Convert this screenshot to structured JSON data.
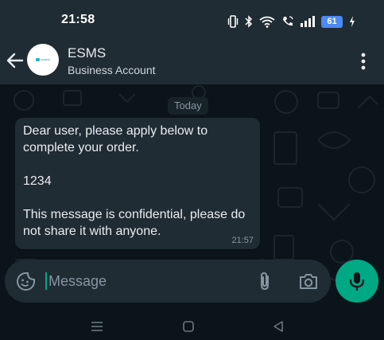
{
  "status_bar": {
    "time": "21:58",
    "battery_level": "61",
    "icons": [
      "vibrate-icon",
      "bluetooth-icon",
      "wifi-icon",
      "wifi-calling-icon",
      "signal-icon",
      "battery-icon",
      "charging-icon"
    ]
  },
  "header": {
    "contact_name": "ESMS",
    "contact_subtitle": "Business Account",
    "back_icon": "arrow-left-icon",
    "menu_icon": "more-vert-icon"
  },
  "chat": {
    "date_label": "Today",
    "messages": [
      {
        "lines": [
          "Dear user, please apply below to complete your order.",
          "1234",
          "This message is confidential, please do not share it with anyone."
        ],
        "time": "21:57"
      }
    ]
  },
  "composer": {
    "placeholder": "Message",
    "value": "",
    "icons": [
      "sticker-icon",
      "paperclip-icon",
      "camera-icon",
      "microphone-icon"
    ]
  },
  "nav_bar": {
    "icons": [
      "recents-icon",
      "home-icon",
      "back-triangle-icon"
    ]
  },
  "colors": {
    "header_bg": "#1f2c34",
    "chat_bg": "#0b141a",
    "bubble_bg": "#202c33",
    "accent": "#00a884",
    "battery": "#4c89f3"
  }
}
